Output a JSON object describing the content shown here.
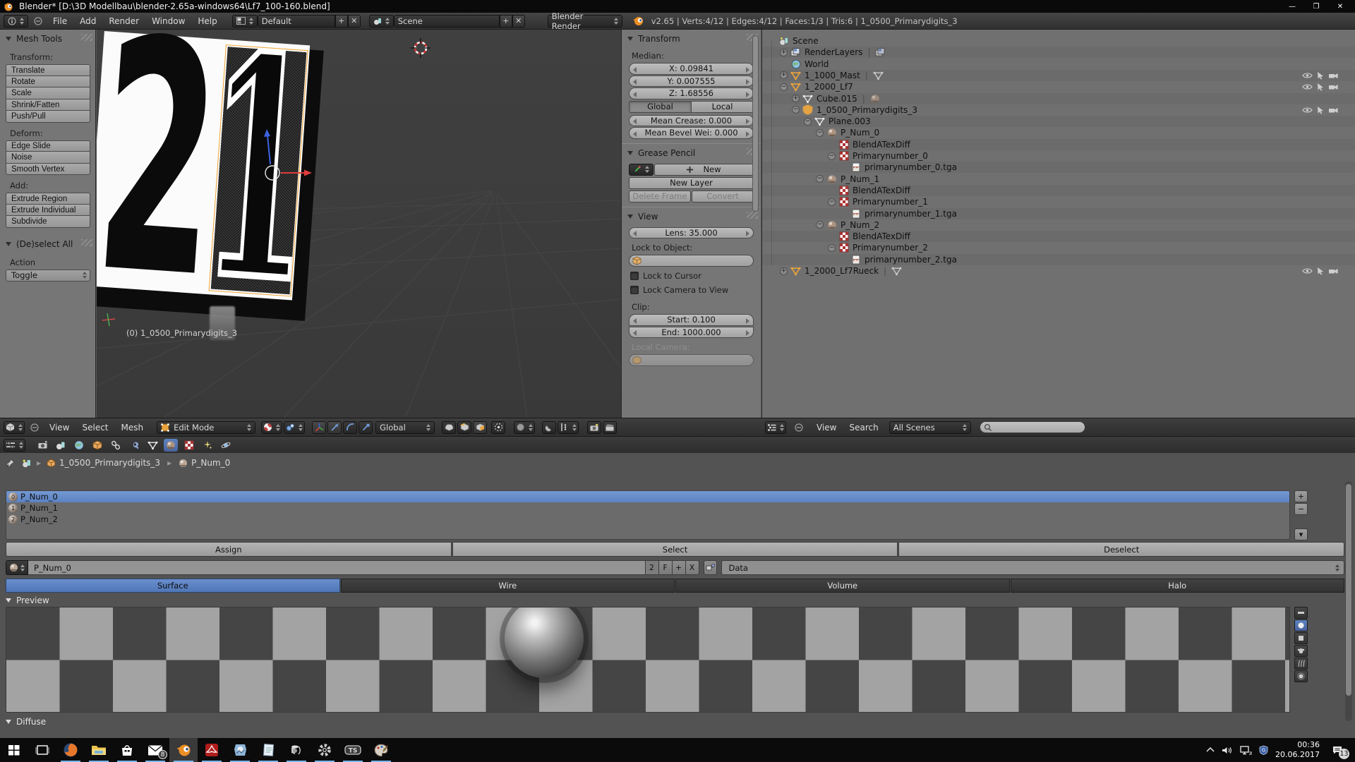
{
  "window": {
    "title": "Blender* [D:\\3D Modellbau\\blender-2.65a-windows64\\Lf7_100-160.blend]",
    "minimize": "—",
    "maximize": "❐",
    "close": "✕"
  },
  "info_bar": {
    "menus": [
      "File",
      "Add",
      "Render",
      "Window",
      "Help"
    ],
    "layout": "Default",
    "scene": "Scene",
    "engine": "Blender Render",
    "stats": "v2.65 | Verts:4/12 | Edges:4/12 | Faces:1/3 | Tris:6 | 1_0500_Primarydigits_3"
  },
  "tool_shelf": {
    "mesh_tools_title": "Mesh Tools",
    "groups": [
      {
        "label": "Transform:",
        "buttons": [
          "Translate",
          "Rotate",
          "Scale",
          "Shrink/Fatten",
          "Push/Pull"
        ]
      },
      {
        "label": "Deform:",
        "buttons": [
          "Edge Slide",
          "Noise",
          "Smooth Vertex"
        ]
      },
      {
        "label": "Add:",
        "buttons": [
          "Extrude Region",
          "Extrude Individual",
          "Subdivide"
        ]
      }
    ],
    "deselect_title": "(De)select All",
    "action_label": "Action",
    "toggle_value": "Toggle"
  },
  "viewport": {
    "object_info": "(0) 1_0500_Primarydigits_3",
    "digit_left": "2",
    "digit_right": "1"
  },
  "view3d_header": {
    "menus": [
      "View",
      "Select",
      "Mesh"
    ],
    "mode": "Edit Mode",
    "orientation": "Global"
  },
  "n_panel": {
    "transform": {
      "title": "Transform",
      "median_label": "Median:",
      "x": "X: 0.09841",
      "y": "Y: 0.007555",
      "z": "Z: 1.68556",
      "global": "Global",
      "local": "Local",
      "mean_crease": "Mean Crease: 0.000",
      "mean_bevel": "Mean Bevel Wei: 0.000"
    },
    "grease_pencil": {
      "title": "Grease Pencil",
      "new": "New",
      "new_layer": "New Layer",
      "delete_frame": "Delete Frame",
      "convert": "Convert"
    },
    "view": {
      "title": "View",
      "lens": "Lens: 35.000",
      "lock_to_object": "Lock to Object:",
      "lock_to_cursor": "Lock to Cursor",
      "lock_camera": "Lock Camera to View",
      "clip_label": "Clip:",
      "clip_start": "Start: 0.100",
      "clip_end": "End: 1000.000",
      "local_camera": "Local Camera:"
    }
  },
  "outliner": {
    "header": {
      "view": "View",
      "search": "Search",
      "scenes": "All Scenes"
    },
    "rows": [
      {
        "d": 0,
        "icon": "scene",
        "label": "Scene"
      },
      {
        "d": 1,
        "t": "+",
        "icon": "renderlayers",
        "label": "RenderLayers",
        "suffix": "renderlayers"
      },
      {
        "d": 1,
        "icon": "world",
        "label": "World"
      },
      {
        "d": 1,
        "t": "+",
        "icon": "mesh-orange",
        "label": "1_1000_Mast",
        "suffix": "mesh",
        "restrict": true
      },
      {
        "d": 1,
        "t": "-",
        "icon": "mesh-orange",
        "label": "1_2000_Lf7",
        "restrict": true
      },
      {
        "d": 2,
        "t": "+",
        "icon": "mesh-grey",
        "label": "Cube.015",
        "suffix": "material"
      },
      {
        "d": 2,
        "t": "-",
        "icon": "mesh-orange",
        "label": "1_0500_Primarydigits_3",
        "active": true,
        "restrict": true
      },
      {
        "d": 3,
        "t": "-",
        "icon": "mesh-grey",
        "label": "Plane.003"
      },
      {
        "d": 4,
        "t": "-",
        "icon": "material",
        "label": "P_Num_0"
      },
      {
        "d": 5,
        "icon": "texture",
        "label": "BlendATexDiff"
      },
      {
        "d": 5,
        "t": "-",
        "icon": "texture",
        "label": "Primarynumber_0"
      },
      {
        "d": 6,
        "icon": "image",
        "label": "primarynumber_0.tga"
      },
      {
        "d": 4,
        "t": "-",
        "icon": "material",
        "label": "P_Num_1"
      },
      {
        "d": 5,
        "icon": "texture",
        "label": "BlendATexDiff"
      },
      {
        "d": 5,
        "t": "-",
        "icon": "texture",
        "label": "Primarynumber_1"
      },
      {
        "d": 6,
        "icon": "image",
        "label": "primarynumber_1.tga"
      },
      {
        "d": 4,
        "t": "-",
        "icon": "material",
        "label": "P_Num_2"
      },
      {
        "d": 5,
        "icon": "texture",
        "label": "BlendATexDiff"
      },
      {
        "d": 5,
        "t": "-",
        "icon": "texture",
        "label": "Primarynumber_2"
      },
      {
        "d": 6,
        "icon": "image",
        "label": "primarynumber_2.tga"
      },
      {
        "d": 1,
        "t": "+",
        "icon": "mesh-orange",
        "label": "1_2000_Lf7Rueck",
        "suffix": "mesh",
        "restrict": true
      }
    ]
  },
  "properties": {
    "breadcrumb": {
      "object": "1_0500_Primarydigits_3",
      "material": "P_Num_0"
    },
    "slots": [
      {
        "label": "P_Num_0",
        "digit": "0",
        "selected": true
      },
      {
        "label": "P_Num_1",
        "digit": "1",
        "selected": false
      },
      {
        "label": "P_Num_2",
        "digit": "2",
        "selected": false
      }
    ],
    "actions": [
      "Assign",
      "Select",
      "Deselect"
    ],
    "datablock": {
      "name": "P_Num_0",
      "users": "2",
      "fake": "F",
      "add": "+",
      "unlink": "X",
      "data": "Data"
    },
    "tabs": [
      "Surface",
      "Wire",
      "Volume",
      "Halo"
    ],
    "active_tab": "Surface",
    "preview_title": "Preview",
    "diffuse_title": "Diffuse"
  },
  "taskbar": {
    "apps": [
      {
        "name": "start"
      },
      {
        "name": "task-view"
      },
      {
        "name": "firefox",
        "running": true
      },
      {
        "name": "explorer",
        "running": true
      },
      {
        "name": "store",
        "running": true
      },
      {
        "name": "mail",
        "running": true,
        "badge": "8"
      },
      {
        "name": "blender",
        "running": true,
        "active": true
      },
      {
        "name": "acrobat",
        "running": true
      },
      {
        "name": "photos",
        "running": true
      },
      {
        "name": "notepad",
        "running": true
      },
      {
        "name": "volume-app",
        "running": true
      },
      {
        "name": "settings",
        "running": true
      },
      {
        "name": "teamspeak",
        "running": true
      },
      {
        "name": "paint",
        "running": true
      }
    ],
    "tray": {
      "time": "00:36",
      "date": "20.06.2017",
      "notification_badge": "13"
    }
  },
  "colors": {
    "accent_blue": "#5b82c2",
    "object_orange": "#e89d4d",
    "select_orange": "#f0a22e"
  }
}
